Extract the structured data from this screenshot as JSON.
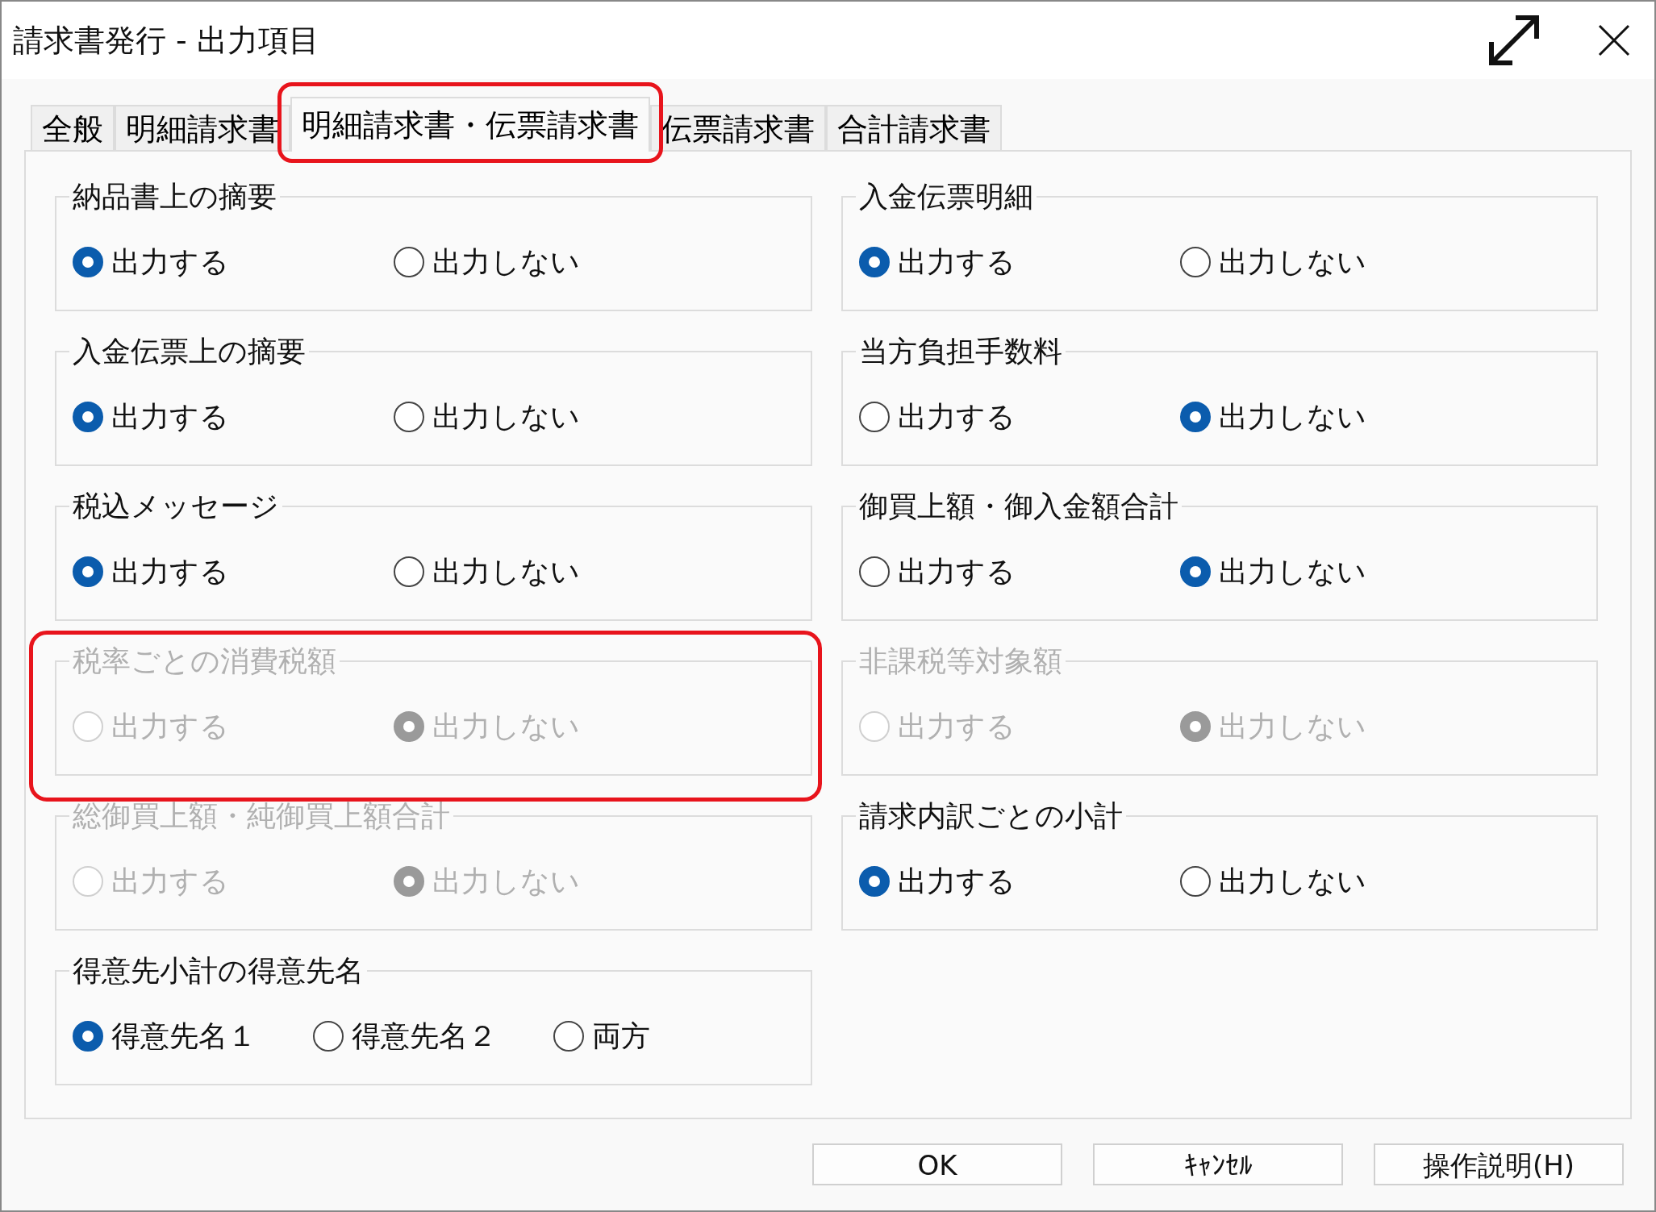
{
  "window": {
    "title": "請求書発行 - 出力項目"
  },
  "tabs": [
    {
      "label": "全般",
      "selected": false,
      "highlighted": false
    },
    {
      "label": "明細請求書",
      "selected": false,
      "highlighted": false
    },
    {
      "label": "明細請求書・伝票請求書",
      "selected": true,
      "highlighted": true
    },
    {
      "label": "伝票請求書",
      "selected": false,
      "highlighted": false
    },
    {
      "label": "合計請求書",
      "selected": false,
      "highlighted": false
    }
  ],
  "groups": [
    {
      "label": "納品書上の摘要",
      "disabled": false,
      "highlighted": false,
      "options": [
        {
          "label": "出力する",
          "selected": true
        },
        {
          "label": "出力しない",
          "selected": false
        }
      ]
    },
    {
      "label": "入金伝票明細",
      "disabled": false,
      "highlighted": false,
      "options": [
        {
          "label": "出力する",
          "selected": true
        },
        {
          "label": "出力しない",
          "selected": false
        }
      ]
    },
    {
      "label": "入金伝票上の摘要",
      "disabled": false,
      "highlighted": false,
      "options": [
        {
          "label": "出力する",
          "selected": true
        },
        {
          "label": "出力しない",
          "selected": false
        }
      ]
    },
    {
      "label": "当方負担手数料",
      "disabled": false,
      "highlighted": false,
      "options": [
        {
          "label": "出力する",
          "selected": false
        },
        {
          "label": "出力しない",
          "selected": true
        }
      ]
    },
    {
      "label": "税込メッセージ",
      "disabled": false,
      "highlighted": false,
      "options": [
        {
          "label": "出力する",
          "selected": true
        },
        {
          "label": "出力しない",
          "selected": false
        }
      ]
    },
    {
      "label": "御買上額・御入金額合計",
      "disabled": false,
      "highlighted": false,
      "options": [
        {
          "label": "出力する",
          "selected": false
        },
        {
          "label": "出力しない",
          "selected": true
        }
      ]
    },
    {
      "label": "税率ごとの消費税額",
      "disabled": true,
      "highlighted": true,
      "options": [
        {
          "label": "出力する",
          "selected": false
        },
        {
          "label": "出力しない",
          "selected": true
        }
      ]
    },
    {
      "label": "非課税等対象額",
      "disabled": true,
      "highlighted": false,
      "options": [
        {
          "label": "出力する",
          "selected": false
        },
        {
          "label": "出力しない",
          "selected": true
        }
      ]
    },
    {
      "label": "総御買上額・純御買上額合計",
      "disabled": true,
      "highlighted": false,
      "options": [
        {
          "label": "出力する",
          "selected": false
        },
        {
          "label": "出力しない",
          "selected": true
        }
      ]
    },
    {
      "label": "請求内訳ごとの小計",
      "disabled": false,
      "highlighted": false,
      "options": [
        {
          "label": "出力する",
          "selected": true
        },
        {
          "label": "出力しない",
          "selected": false
        }
      ]
    },
    {
      "label": "得意先小計の得意先名",
      "disabled": false,
      "highlighted": false,
      "options": [
        {
          "label": "得意先名１",
          "selected": true
        },
        {
          "label": "得意先名２",
          "selected": false
        },
        {
          "label": "両方",
          "selected": false
        }
      ]
    }
  ],
  "buttons": [
    "OK",
    "ｷｬﾝｾﾙ",
    "操作説明(H)"
  ]
}
